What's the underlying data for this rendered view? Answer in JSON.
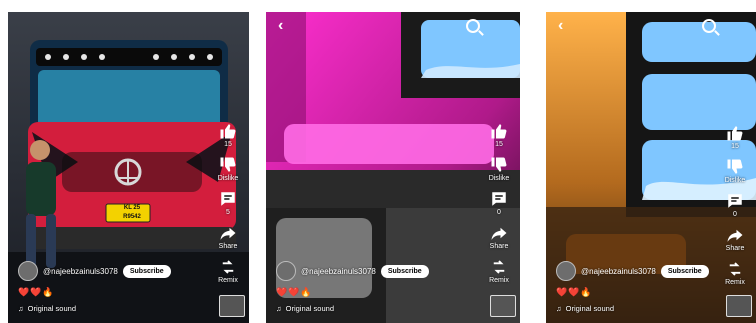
{
  "panels": [
    {
      "like_count": "15",
      "dislike_label": "Dislike",
      "comment_count": "5",
      "share_label": "Share",
      "remix_label": "Remix",
      "channel_handle": "@najeebzainuls3078",
      "subscribe_label": "Subscribe",
      "reactions": "❤️❤️🔥",
      "sound_label": "Original sound",
      "plate_text_line1": "KL 25",
      "plate_text_line2": "R9542"
    },
    {
      "like_count": "15",
      "dislike_label": "Dislike",
      "comment_count": "0",
      "share_label": "Share",
      "remix_label": "Remix",
      "channel_handle": "@najeebzainuls3078",
      "subscribe_label": "Subscribe",
      "reactions": "❤️❤️🔥",
      "sound_label": "Original sound"
    },
    {
      "like_count": "15",
      "dislike_label": "Dislike",
      "comment_count": "0",
      "share_label": "Share",
      "remix_label": "Remix",
      "channel_handle": "@najeebzainuls3078",
      "subscribe_label": "Subscribe",
      "reactions": "❤️❤️🔥",
      "sound_label": "Original sound"
    }
  ],
  "colors": {
    "magenta": "#ff2fd0",
    "amber": "#ffb24a",
    "truck_red": "#d31e3d",
    "ceiling_blue": "#7fc6ff"
  }
}
